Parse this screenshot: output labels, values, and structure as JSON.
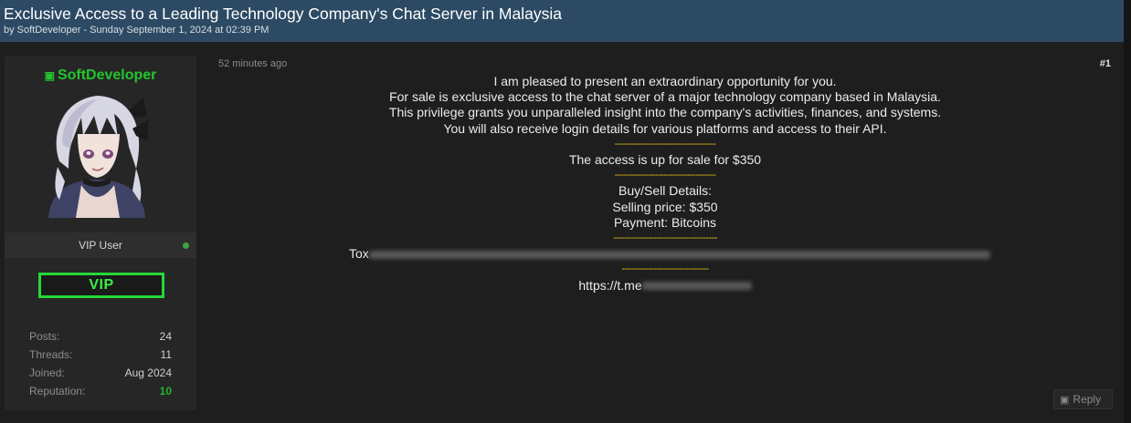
{
  "thread": {
    "title": "Exclusive Access to a Leading Technology Company's Chat Server in Malaysia",
    "meta": "by SoftDeveloper - Sunday September 1, 2024 at 02:39 PM"
  },
  "user": {
    "name": "SoftDeveloper",
    "name_icon": "member-badge-icon",
    "rank": "VIP User",
    "badge": "VIP",
    "stats": [
      {
        "label": "Posts:",
        "value": "24"
      },
      {
        "label": "Threads:",
        "value": "11"
      },
      {
        "label": "Joined:",
        "value": "Aug 2024"
      },
      {
        "label": "Reputation:",
        "value": "10"
      }
    ]
  },
  "post": {
    "time": "52 minutes ago",
    "number": "#1",
    "lines": [
      "I am pleased to present an extraordinary opportunity for you.",
      "For sale is exclusive access to the chat server of a major technology company based in Malaysia.",
      "This privilege grants you unparalleled insight into the company's activities, finances, and systems.",
      "You will also receive login details for various platforms and access to their API."
    ],
    "sep1": "-----------------------------------",
    "sale_line": "The access is up for sale for $350",
    "sep2": "-----------------------------------",
    "details_header": "Buy/Sell Details:",
    "price_line": "Selling price: $350",
    "payment_line": "Payment: Bitcoins",
    "sep3": "------------------------------------",
    "tox_label": "Tox",
    "sep4": "------------------------------",
    "tg_prefix": "https://t.me"
  },
  "actions": {
    "reply_label": "Reply",
    "reply_icon": "quote-icon"
  },
  "colors": {
    "header_bg": "#2c4a63",
    "username_green": "#22c52c",
    "vip_border": "#25d83a",
    "separator_yellow": "#e6c21a",
    "reputation_green": "#24b22e"
  }
}
